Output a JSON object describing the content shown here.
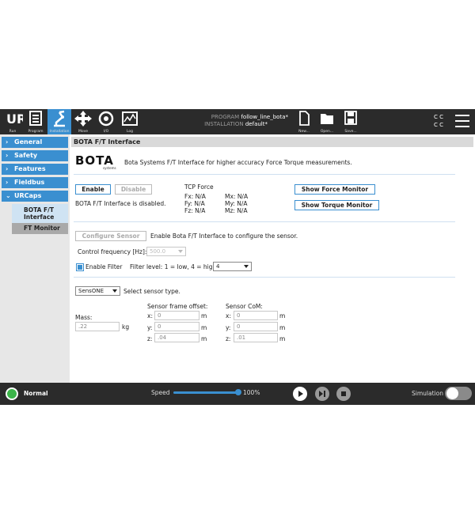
{
  "colors": {
    "accent": "#3a8fd0",
    "topbar": "#2b2b2b",
    "status_ok": "#3cb54a"
  },
  "toolbar": {
    "run": "Run",
    "program": "Program",
    "installation": "Installation",
    "move": "Move",
    "io": "I/O",
    "log": "Log",
    "program_label": "PROGRAM",
    "program_name": "follow_line_bota*",
    "installation_label": "INSTALLATION",
    "installation_name": "default*",
    "new": "New...",
    "open": "Open...",
    "save": "Save...",
    "cc": "C C"
  },
  "sidebar": {
    "items": [
      {
        "label": "General"
      },
      {
        "label": "Safety"
      },
      {
        "label": "Features"
      },
      {
        "label": "Fieldbus"
      },
      {
        "label": "URCaps"
      }
    ],
    "sub_items": [
      {
        "label": "BOTA F/T Interface"
      },
      {
        "label": "FT Monitor"
      }
    ]
  },
  "panel": {
    "title": "BOTA F/T Interface",
    "logo_text": "BOTA",
    "logo_sub": "systems",
    "description": "Bota Systems F/T Interface for higher accuracy Force Torque measurements.",
    "enable": "Enable",
    "disable": "Disable",
    "status": "BOTA F/T Interface is disabled.",
    "tcp_force": "TCP Force",
    "fx": "Fx: N/A",
    "fy": "Fy: N/A",
    "fz": "Fz: N/A",
    "mx": "Mx: N/A",
    "my": "My: N/A",
    "mz": "Mz: N/A",
    "show_force": "Show Force Monitor",
    "show_torque": "Show Torque Monitor",
    "configure": "Configure Sensor",
    "configure_hint": "Enable Bota F/T Interface to configure the sensor.",
    "control_freq_label": "Control frequency [Hz]:",
    "control_freq_value": "500.0",
    "enable_filter": "Enable Filter",
    "filter_level_label": "Filter level: 1 = low, 4 = high",
    "filter_level_value": "4",
    "sensor_type_value": "SensONE",
    "sensor_type_label": "Select sensor type.",
    "mass_label": "Mass:",
    "mass_value": ".22",
    "mass_unit": "kg",
    "frame_offset_label": "Sensor frame offset:",
    "com_label": "Sensor CoM:",
    "x": "x:",
    "y": "y:",
    "z": "z:",
    "unit_m": "m",
    "offset_x": "0",
    "offset_y": "0",
    "offset_z": ".04",
    "com_x": "0",
    "com_y": "0",
    "com_z": ".01"
  },
  "bottom": {
    "status": "Normal",
    "speed_label": "Speed",
    "speed_value": "100%",
    "speed_fraction": 1.0,
    "simulation": "Simulation"
  }
}
